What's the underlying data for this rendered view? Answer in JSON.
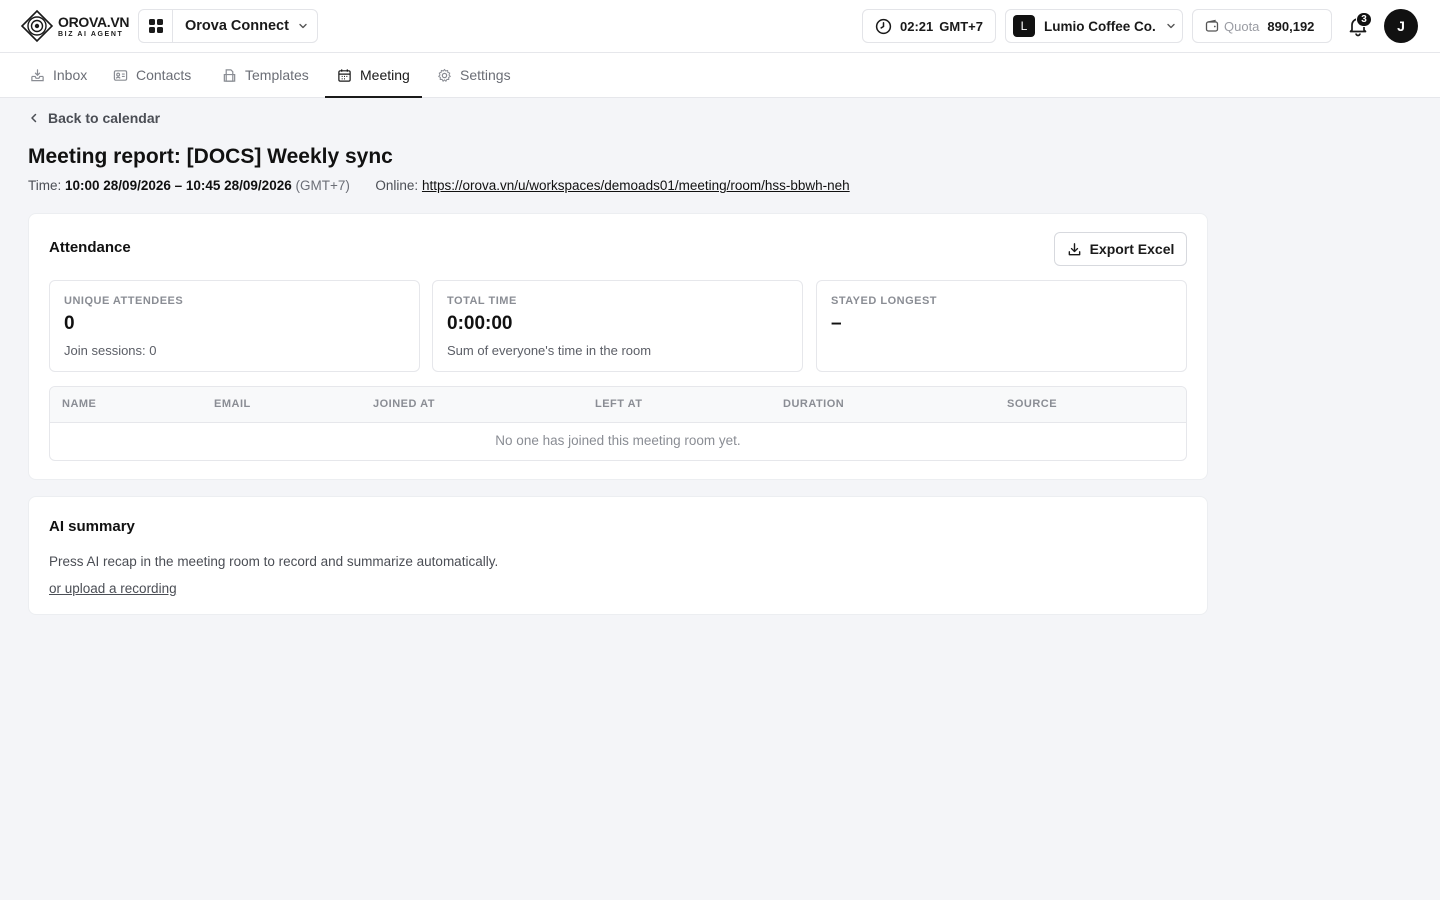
{
  "header": {
    "logo": {
      "main": "OROVA.VN",
      "sub": "BIZ AI AGENT"
    },
    "app_switcher": {
      "label": "Orova Connect"
    },
    "time": {
      "value": "02:21",
      "timezone": "GMT+7"
    },
    "org": {
      "initial": "L",
      "name": "Lumio Coffee Co."
    },
    "quota": {
      "label": "Quota",
      "value": "890,192"
    },
    "notifications": {
      "count": "3"
    },
    "user": {
      "initial": "J"
    }
  },
  "nav": {
    "tabs": [
      {
        "label": "Inbox",
        "icon": "inbox-icon"
      },
      {
        "label": "Contacts",
        "icon": "contacts-icon"
      },
      {
        "label": "Templates",
        "icon": "templates-icon"
      },
      {
        "label": "Meeting",
        "icon": "calendar-icon",
        "active": true
      },
      {
        "label": "Settings",
        "icon": "gear-icon"
      }
    ]
  },
  "page": {
    "back_label": "Back to calendar",
    "title": "Meeting report: [DOCS] Weekly sync",
    "time_label": "Time:",
    "time_range": "10:00 28/09/2026 – 10:45 28/09/2026",
    "timezone": "(GMT+7)",
    "online_label": "Online:",
    "online_url": "https://orova.vn/u/workspaces/demoads01/meeting/room/hss-bbwh-neh"
  },
  "attendance": {
    "title": "Attendance",
    "export_label": "Export Excel",
    "stats": [
      {
        "label": "UNIQUE ATTENDEES",
        "value": "0",
        "sub": "Join sessions: 0"
      },
      {
        "label": "TOTAL TIME",
        "value": "0:00:00",
        "sub": "Sum of everyone's time in the room"
      },
      {
        "label": "STAYED LONGEST",
        "value": "–",
        "sub": ""
      }
    ],
    "columns": [
      "NAME",
      "EMAIL",
      "JOINED AT",
      "LEFT AT",
      "DURATION",
      "SOURCE"
    ],
    "empty_text": "No one has joined this meeting room yet."
  },
  "ai_summary": {
    "title": "AI summary",
    "description": "Press AI recap in the meeting room to record and summarize automatically.",
    "upload_link": "or upload a recording"
  },
  "colors": {
    "background": "#f4f5f8",
    "surface": "#ffffff",
    "border": "#e6e7eb",
    "text_primary": "#111111",
    "text_muted": "#8a8d94",
    "accent_dark": "#111111"
  }
}
